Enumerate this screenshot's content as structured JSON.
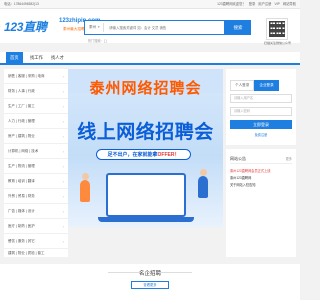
{
  "topbar": {
    "hotline": "电话：17864496382(13",
    "links": [
      "123直聘网欢迎您！",
      "登录",
      "用户注册",
      "VIP",
      "网站导航"
    ]
  },
  "header": {
    "logo_text": "123直聘",
    "logo_url": "123zhipin.com",
    "logo_slogan": "泰州最大招聘网",
    "search": {
      "city": "泰州",
      "placeholder": "请输入搜索关键词 如：会计 文员 销售",
      "button": "搜索",
      "hot_words": "热门搜索：[ ]"
    },
    "qr_caption": "扫描关注微信公众号"
  },
  "nav": {
    "items": [
      "首页",
      "找工作",
      "找人才"
    ],
    "active_index": 0
  },
  "categories": [
    "销售 | 客服 | 采购 | 电商",
    "财务 | 人事 | 行政",
    "生产 | 工厂 | 普工",
    "人力 | 行政 | 管理",
    "房产 | 建筑 | 物业",
    "计算机 | 网络 | 技术",
    "生产 | 物流 | 管理",
    "教育 | 培训 | 翻译",
    "外贸 | 贸易 | 财务",
    "广告 | 媒体 | 设计",
    "医疗 | 制药 | 医护",
    "餐饮 | 服务 | 其它",
    "建筑 | 物业 | 质检 | 普工"
  ],
  "banner": {
    "title_top": "泰州网络招聘会",
    "title_main": "线上网络招聘会",
    "pill_text": "足不出户，在家就能拿",
    "pill_highlight": "OFFER！",
    "active_slide": 0,
    "slide_count": 4
  },
  "login": {
    "tabs": [
      "个人登录",
      "企业登录"
    ],
    "active_tab": 1,
    "username_placeholder": "请输入用户名",
    "password_placeholder": "请输入密码",
    "button": "立即登录",
    "register": "免费注册"
  },
  "notice": {
    "title": "网站公告",
    "more": "更多",
    "items": [
      {
        "text": "泰州123直聘网会员正式上线",
        "color": "#e53935"
      },
      {
        "text": "泰州123直聘网",
        "color": "#333333"
      },
      {
        "text": "关于网站入驻告知",
        "color": "#333333"
      }
    ]
  },
  "famous": {
    "title": "名企招聘",
    "view_more": "查看更多"
  },
  "colors": {
    "brand": "#1f7fe0",
    "accent_orange": "#ff5a00",
    "banner_blue": "#0b5ed7"
  }
}
